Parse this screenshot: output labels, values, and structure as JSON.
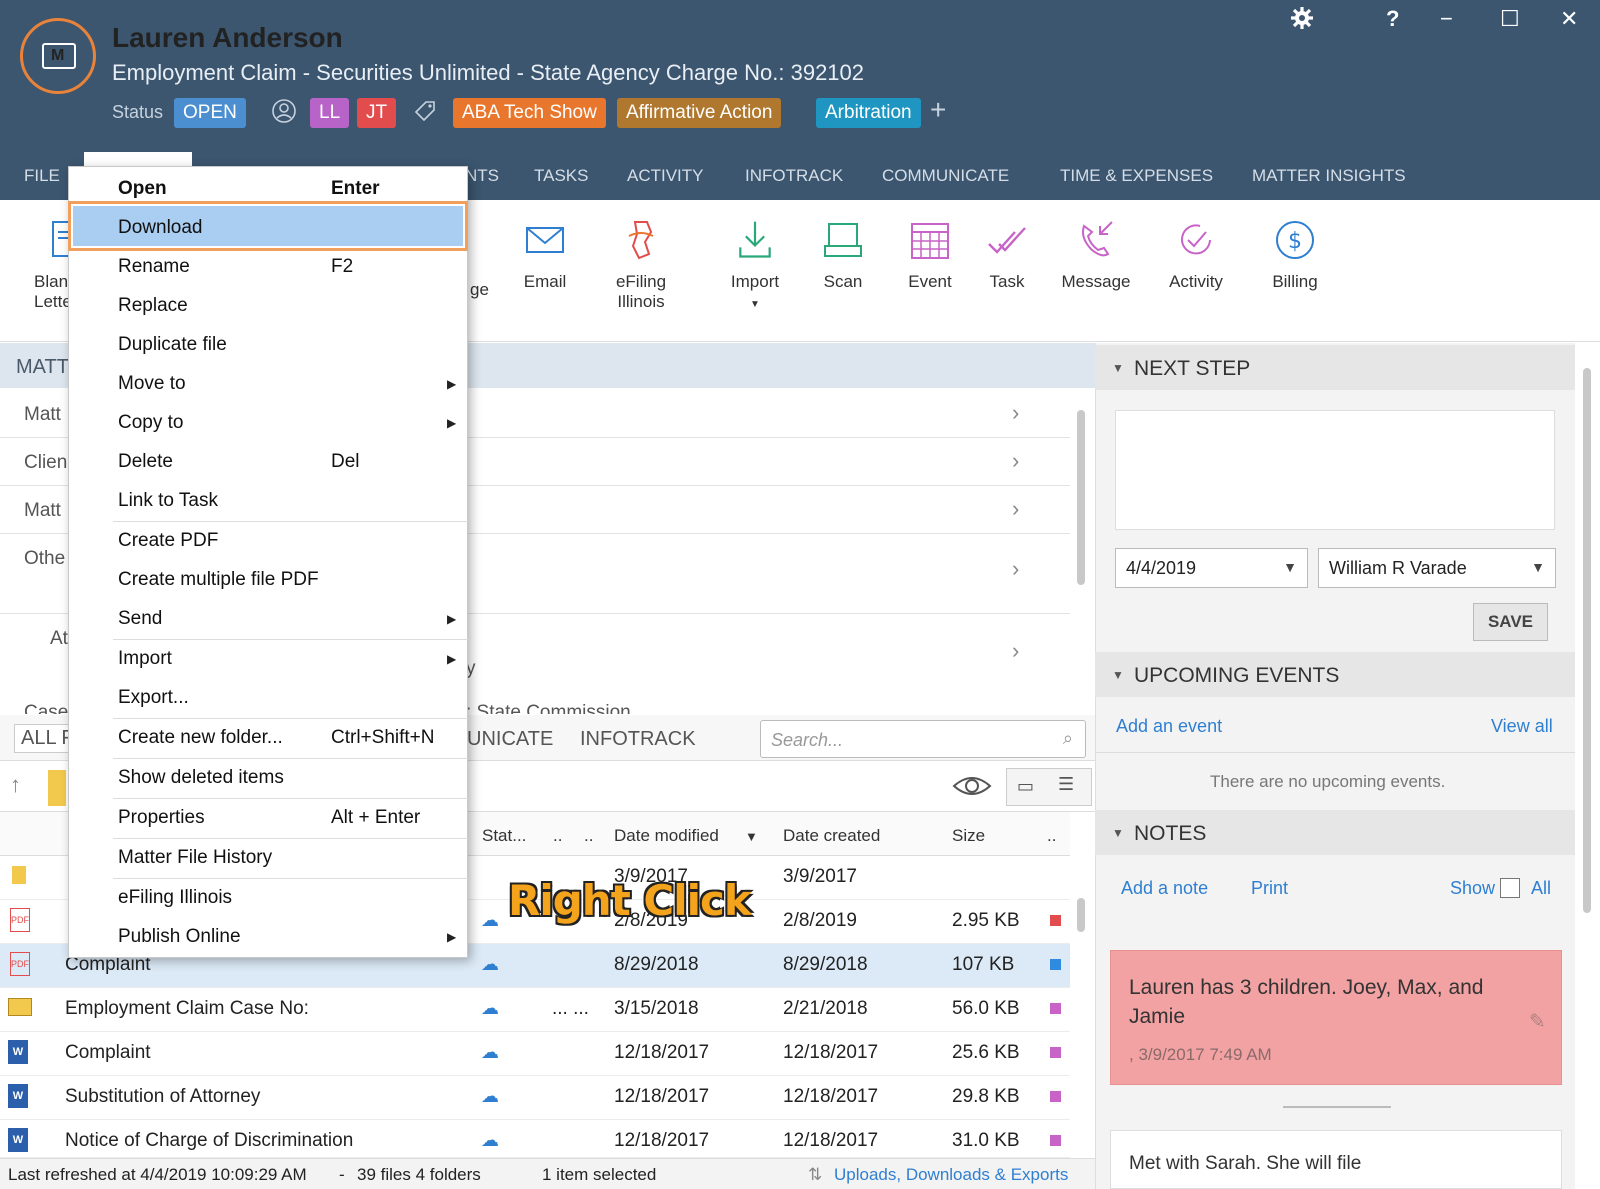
{
  "header": {
    "client_name": "Lauren Anderson",
    "matter_title": "Employment Claim - Securities Unlimited - State Agency Charge No.: 392102",
    "status_label": "Status",
    "status_value": "OPEN",
    "assignees": [
      "LL",
      "JT"
    ],
    "tags": [
      "ABA Tech Show",
      "Affirmative Action",
      "Arbitration"
    ],
    "add_symbol": "+",
    "window_controls": {
      "help": "?",
      "minimize": "−",
      "maximize": "☐",
      "close": "✕"
    }
  },
  "nav": {
    "items": [
      "FILE",
      "NTS",
      "TASKS",
      "ACTIVITY",
      "INFOTRACK",
      "COMMUNICATE",
      "TIME & EXPENSES",
      "MATTER INSIGHTS"
    ]
  },
  "ribbon": {
    "blank_letter": [
      "Blan",
      "Lette"
    ],
    "ge_fragment": "ge",
    "email": "Email",
    "efiling": [
      "eFiling",
      "Illinois"
    ],
    "import": "Import",
    "scan": "Scan",
    "event": "Event",
    "task": "Task",
    "message": "Message",
    "activity": "Activity",
    "billing": "Billing"
  },
  "matter": {
    "section_label": "MATT",
    "rows": [
      "Matt",
      "Clien",
      "Matt",
      "Othe",
      "At",
      "Case"
    ],
    "fragment_y": "y",
    "fragment_state": ": State Commission"
  },
  "files": {
    "tab_all": "ALL F",
    "tab_communicate": "UNICATE",
    "tab_infotrack": "INFOTRACK",
    "search_placeholder": "Search...",
    "columns": {
      "status": "Stat...",
      "dot1": "..",
      "dot2": "..",
      "date_modified": "Date modified",
      "date_created": "Date created",
      "size": "Size",
      "dot3": ".."
    },
    "rows": [
      {
        "name": "",
        "dots": "",
        "modified": "3/9/2017",
        "created": "3/9/2017",
        "size": "",
        "color": ""
      },
      {
        "name": "",
        "dots": "",
        "modified": "2/8/2019",
        "created": "2/8/2019",
        "size": "2.95 KB",
        "color": "#e24c4c"
      },
      {
        "name": "Complaint",
        "dots": "",
        "modified": "8/29/2018",
        "created": "8/29/2018",
        "size": "107 KB",
        "color": "#2f8be0"
      },
      {
        "name": "Employment Claim Case No:",
        "dots": "...   ...",
        "modified": "3/15/2018",
        "created": "2/21/2018",
        "size": "56.0 KB",
        "color": "#c863c8"
      },
      {
        "name": "Complaint",
        "dots": "",
        "modified": "12/18/2017",
        "created": "12/18/2017",
        "size": "25.6 KB",
        "color": "#c863c8"
      },
      {
        "name": "Substitution of Attorney",
        "dots": "",
        "modified": "12/18/2017",
        "created": "12/18/2017",
        "size": "29.8 KB",
        "color": "#c863c8"
      },
      {
        "name": "Notice of Charge of Discrimination",
        "dots": "",
        "modified": "12/18/2017",
        "created": "12/18/2017",
        "size": "31.0 KB",
        "color": "#c863c8"
      }
    ]
  },
  "statusbar": {
    "refreshed": "Last refreshed at 4/4/2019 10:09:29 AM",
    "sep": "-",
    "counts": "39 files  4 folders",
    "selected": "1 item selected",
    "uploads": "Uploads, Downloads & Exports"
  },
  "right": {
    "next_step": "NEXT STEP",
    "date_value": "4/4/2019",
    "assignee_value": "William R Varade",
    "save": "SAVE",
    "upcoming": "UPCOMING EVENTS",
    "add_event": "Add an event",
    "view_all": "View all",
    "no_events": "There are no upcoming events.",
    "notes": "NOTES",
    "add_note": "Add a note",
    "print": "Print",
    "show": "Show",
    "all": "All",
    "note1_text": "Lauren has 3 children. Joey, Max, and Jamie",
    "note1_date": ", 3/9/2017 7:49 AM",
    "note2_text": "Met with Sarah. She will file"
  },
  "context_menu": {
    "items": [
      {
        "label": "Open",
        "shortcut": "Enter"
      },
      {
        "label": "Download",
        "shortcut": ""
      },
      {
        "label": "Rename",
        "shortcut": "F2"
      },
      {
        "label": "Replace",
        "shortcut": ""
      },
      {
        "label": "Duplicate file",
        "shortcut": ""
      },
      {
        "label": "Move to",
        "shortcut": ""
      },
      {
        "label": "Copy to",
        "shortcut": ""
      },
      {
        "label": "Delete",
        "shortcut": "Del"
      },
      {
        "label": "Link to Task",
        "shortcut": ""
      },
      {
        "label": "Create PDF",
        "shortcut": ""
      },
      {
        "label": "Create multiple file PDF",
        "shortcut": ""
      },
      {
        "label": "Send",
        "shortcut": ""
      },
      {
        "label": "Import",
        "shortcut": ""
      },
      {
        "label": "Export...",
        "shortcut": ""
      },
      {
        "label": "Create new folder...",
        "shortcut": "Ctrl+Shift+N"
      },
      {
        "label": "Show deleted items",
        "shortcut": ""
      },
      {
        "label": "Properties",
        "shortcut": "Alt + Enter"
      },
      {
        "label": "Matter File History",
        "shortcut": ""
      },
      {
        "label": "eFiling Illinois",
        "shortcut": ""
      },
      {
        "label": "Publish Online",
        "shortcut": ""
      }
    ]
  },
  "overlay": {
    "annotation": "Right Click"
  },
  "colors": {
    "header_bg": "#3c5670",
    "accent": "#2f7fd1",
    "highlight": "#aacdf2",
    "focus_outline": "#f0a05c"
  },
  "icons": [
    "settings-gear-icon",
    "help-icon",
    "minimize-icon",
    "maximize-icon",
    "close-icon",
    "tag-icon",
    "person-icon",
    "email-icon",
    "efiling-icon",
    "download-icon",
    "scan-icon",
    "calendar-icon",
    "task-icon",
    "message-icon",
    "activity-icon",
    "billing-dollar-icon",
    "cloud-icon",
    "pdf-icon",
    "word-icon",
    "folder-icon",
    "eye-icon",
    "pin-icon"
  ]
}
